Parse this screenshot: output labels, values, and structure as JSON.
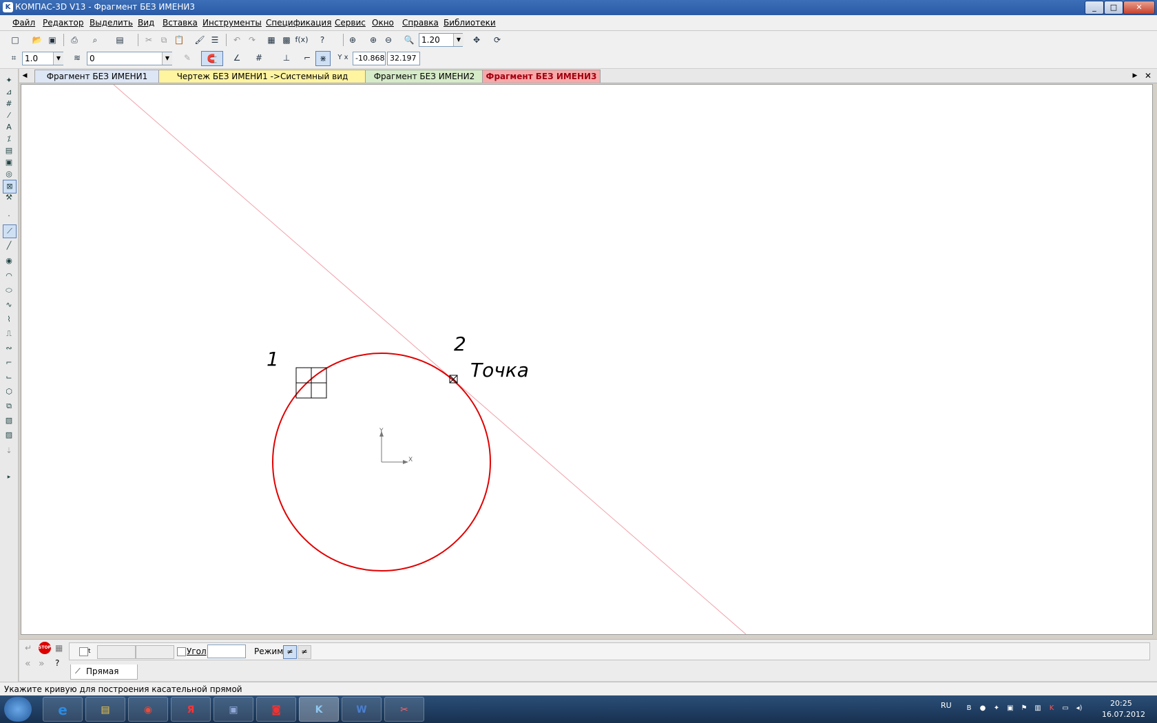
{
  "window": {
    "title": "КОМПАС-3D V13 - Фрагмент БЕЗ ИМЕНИ3",
    "minimize": "_",
    "maximize": "□",
    "close": "✕"
  },
  "menu": {
    "items": [
      "Файл",
      "Редактор",
      "Выделить",
      "Вид",
      "Вставка",
      "Инструменты",
      "Спецификация",
      "Сервис",
      "Окно",
      "Справка",
      "Библиотеки"
    ]
  },
  "toolbar1": {
    "zoom": "1.20"
  },
  "toolbar2": {
    "step": "1.0",
    "layer": "0",
    "coord_x": "-10.868",
    "coord_y": "32.197"
  },
  "tabs": [
    {
      "label": "Фрагмент БЕЗ ИМЕНИ1",
      "color": "#dde6f5"
    },
    {
      "label": "Чертеж БЕЗ ИМЕНИ1 ->Системный вид",
      "color": "#fff4a0"
    },
    {
      "label": "Фрагмент БЕЗ ИМЕНИ2",
      "color": "#d6ebc8"
    },
    {
      "label": "Фрагмент БЕЗ ИМЕНИ3",
      "color": "#f7a9a9"
    }
  ],
  "drawing": {
    "label1": "1",
    "label2": "2",
    "point_label": "Точка",
    "axis_x": "X",
    "axis_y": "Y"
  },
  "propbar": {
    "field_t": "t",
    "angle_label": "Угол",
    "mode_label": "Режим",
    "tab_label": "Прямая",
    "stop": "STOP"
  },
  "status": {
    "text": "Укажите кривую для построения касательной прямой"
  },
  "taskbar": {
    "lang": "RU",
    "time": "20:25",
    "date": "16.07.2012"
  },
  "colors": {
    "circle": "#e00000",
    "construction_line": "#f0a0a8",
    "active_tab": "#c8000a"
  }
}
